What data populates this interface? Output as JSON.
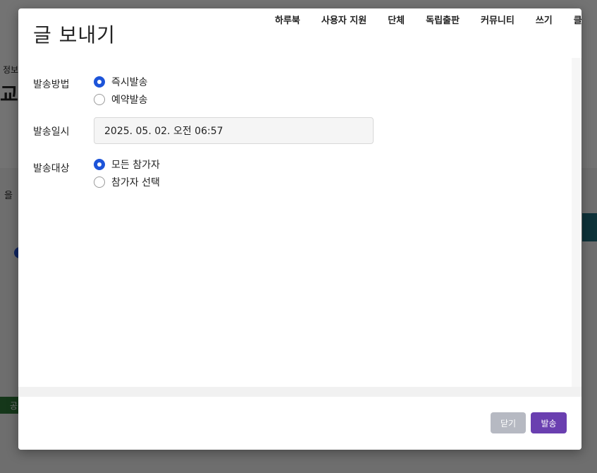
{
  "modal": {
    "title": "글 보내기"
  },
  "topnav": {
    "items": [
      "하루북",
      "사용자 지원",
      "단체",
      "독립출판",
      "커뮤니티",
      "쓰기",
      "클럽"
    ]
  },
  "form": {
    "method": {
      "label": "발송방법",
      "options": [
        {
          "label": "즉시발송",
          "checked": true
        },
        {
          "label": "예약발송",
          "checked": false
        }
      ]
    },
    "datetime": {
      "label": "발송일시",
      "value": "2025. 05. 02. 오전 06:57"
    },
    "target": {
      "label": "발송대상",
      "options": [
        {
          "label": "모든 참가자",
          "checked": true
        },
        {
          "label": "참가자 선택",
          "checked": false
        }
      ]
    }
  },
  "footer": {
    "close_label": "닫기",
    "send_label": "발송"
  },
  "background": {
    "fragments": [
      "정보",
      "교",
      "을",
      "보",
      "공"
    ]
  },
  "colors": {
    "primary_radio": "#1d54d9",
    "send_button": "#6a3fb0",
    "close_button": "#b6b9c2"
  }
}
